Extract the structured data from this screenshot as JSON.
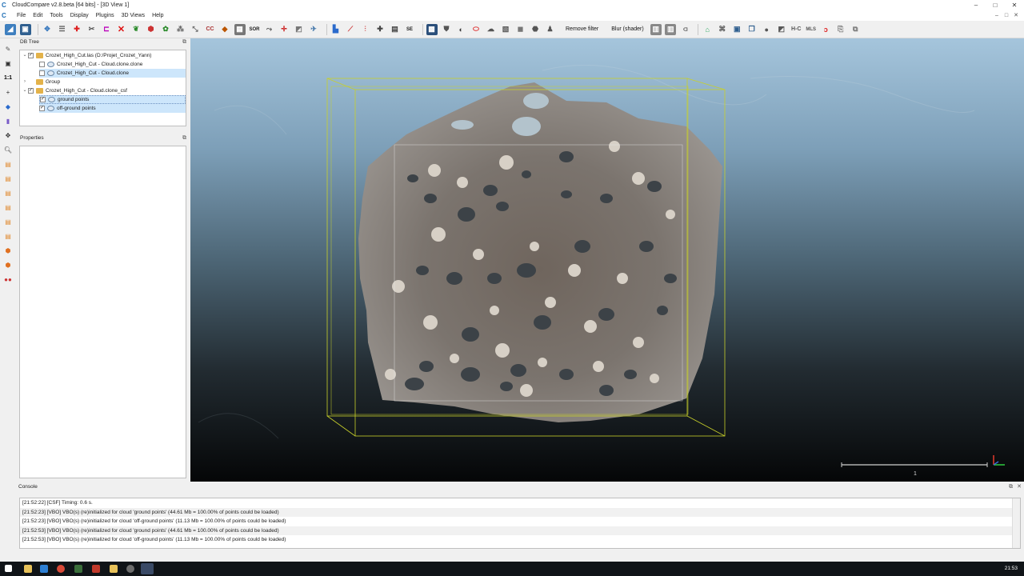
{
  "window": {
    "title": "CloudCompare v2.8.beta [64 bits] - [3D View 1]",
    "controls": [
      "–",
      "□",
      "✕"
    ]
  },
  "menubar": {
    "items": [
      "File",
      "Edit",
      "Tools",
      "Display",
      "Plugins",
      "3D Views",
      "Help"
    ],
    "mdi_controls": [
      "–",
      "□",
      "✕"
    ]
  },
  "toolbar": {
    "remove_filter_label": "Remove filter",
    "blur_shader_label": "Blur (shader)",
    "sor_label": "SOR",
    "se_label": "SE",
    "mls_label": "MLS"
  },
  "db_tree": {
    "title": "DB Tree",
    "items": [
      {
        "label": "Crozet_High_Cut.las (D:/Projet_Crozet_Yann)",
        "type": "folder"
      },
      {
        "label": "Crozet_High_Cut - Cloud.clone.clone",
        "type": "cloud"
      },
      {
        "label": "Crozet_High_Cut - Cloud.clone",
        "type": "cloud"
      },
      {
        "label": "Group",
        "type": "folder"
      },
      {
        "label": "Crozet_High_Cut - Cloud.clone_csf",
        "type": "folder"
      },
      {
        "label": "ground points",
        "type": "cloud"
      },
      {
        "label": "off-ground points",
        "type": "cloud"
      }
    ]
  },
  "properties": {
    "title": "Properties"
  },
  "view": {
    "scale_label": "1"
  },
  "console": {
    "title": "Console",
    "lines": [
      "[21:52:22] [CSF] Timing: 0.6 s.",
      "[21:52:23] [VBO] VBO(s) (re)initialized for cloud 'ground points' (44.61 Mb = 100.00% of points could be loaded)",
      "[21:52:23] [VBO] VBO(s) (re)initialized for cloud 'off-ground points' (11.13 Mb = 100.00% of points could be loaded)",
      "[21:52:53] [VBO] VBO(s) (re)initialized for cloud 'ground points' (44.61 Mb = 100.00% of points could be loaded)",
      "[21:52:53] [VBO] VBO(s) (re)initialized for cloud 'off-ground points' (11.13 Mb = 100.00% of points could be loaded)"
    ]
  },
  "taskbar": {
    "clock": "21:53"
  },
  "colors": {
    "accent": "#1f6fb5",
    "bbox": "#c8d02a",
    "selection": "#cde6fb"
  }
}
